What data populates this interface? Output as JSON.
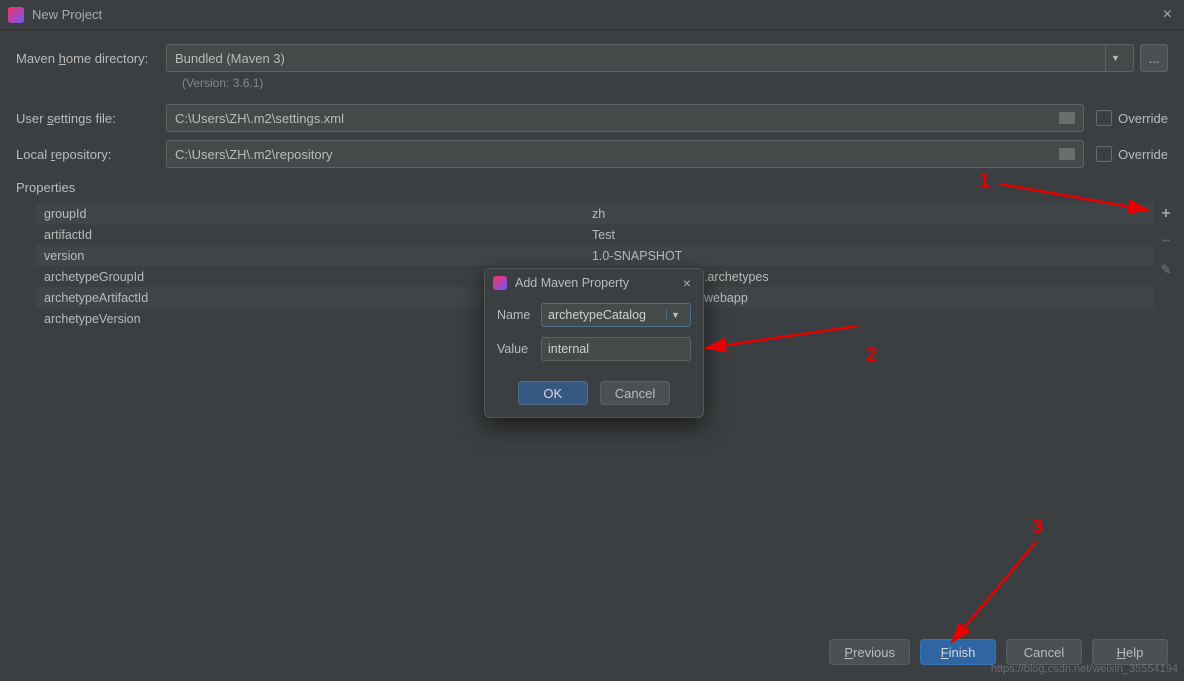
{
  "window": {
    "title": "New Project",
    "close": "×"
  },
  "form": {
    "maven_home_label_pre": "Maven ",
    "maven_home_label_ul": "h",
    "maven_home_label_post": "ome directory:",
    "maven_home_value": "Bundled (Maven 3)",
    "ellipsis": "...",
    "version_note": "(Version: 3.6.1)",
    "settings_label_pre": "User ",
    "settings_label_ul": "s",
    "settings_label_post": "ettings file:",
    "settings_value": "C:\\Users\\ZH\\.m2\\settings.xml",
    "repo_label_pre": "Local ",
    "repo_label_ul": "r",
    "repo_label_post": "epository:",
    "repo_value": "C:\\Users\\ZH\\.m2\\repository",
    "override": "Override"
  },
  "properties": {
    "title": "Properties",
    "rows": [
      {
        "k": "groupId",
        "v": "zh"
      },
      {
        "k": "artifactId",
        "v": "Test"
      },
      {
        "k": "version",
        "v": "1.0-SNAPSHOT"
      },
      {
        "k": "archetypeGroupId",
        "v": ".archetypes"
      },
      {
        "k": "archetypeArtifactId",
        "v": "webapp"
      },
      {
        "k": "archetypeVersion",
        "v": ""
      }
    ],
    "add": "+",
    "remove": "−",
    "edit": "✎"
  },
  "modal": {
    "title": "Add Maven Property",
    "close": "×",
    "name_label": "Name",
    "name_value": "archetypeCatalog",
    "value_label": "Value",
    "value_value": "internal",
    "ok": "OK",
    "cancel": "Cancel"
  },
  "footer": {
    "previous_ul": "P",
    "previous_rest": "revious",
    "finish_ul": "F",
    "finish_rest": "inish",
    "cancel": "Cancel",
    "help_ul": "H",
    "help_rest": "elp"
  },
  "annotations": {
    "a1": "1",
    "a2": "2",
    "a3": "3"
  },
  "watermark": "https://blog.csdn.net/weixin_35554194"
}
